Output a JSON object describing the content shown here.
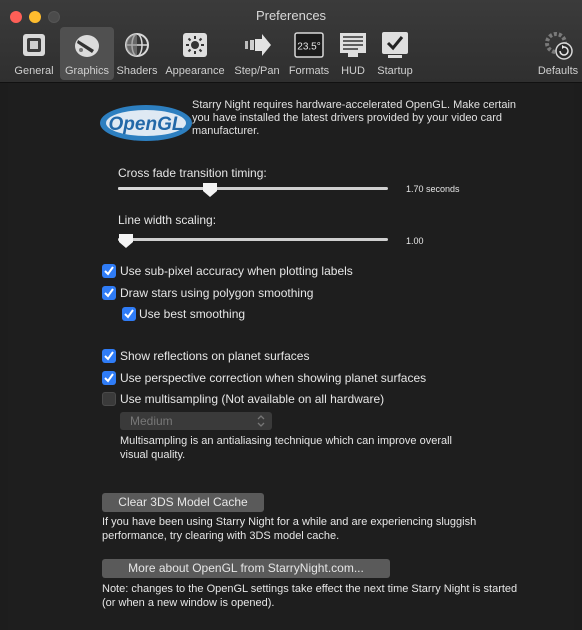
{
  "window": {
    "title": "Preferences"
  },
  "toolbar": {
    "items": [
      {
        "label": "General",
        "icon": "general-icon"
      },
      {
        "label": "Graphics",
        "icon": "graphics-icon",
        "selected": true
      },
      {
        "label": "Shaders",
        "icon": "shaders-icon"
      },
      {
        "label": "Appearance",
        "icon": "appearance-icon"
      },
      {
        "label": "Step/Pan",
        "icon": "step-pan-icon"
      },
      {
        "label": "Formats",
        "icon": "formats-icon",
        "icon_text": "23.5°"
      },
      {
        "label": "HUD",
        "icon": "hud-icon"
      },
      {
        "label": "Startup",
        "icon": "startup-icon"
      },
      {
        "label": "Defaults",
        "icon": "defaults-icon"
      }
    ]
  },
  "opengl": {
    "logo_text": "OpenGL",
    "intro": "Starry Night requires hardware-accelerated OpenGL. Make certain you have installed the latest drivers provided by your video card manufacturer."
  },
  "sliders": {
    "cross_fade": {
      "label": "Cross fade transition timing:",
      "value_text": "1.70 seconds",
      "fraction": 0.34
    },
    "line_width": {
      "label": "Line width scaling:",
      "value_text": "1.00",
      "fraction": 0.03
    }
  },
  "checkboxes": {
    "subpixel": {
      "label": "Use sub-pixel accuracy when plotting labels",
      "checked": true
    },
    "polygon": {
      "label": "Draw stars using polygon smoothing",
      "checked": true
    },
    "best_smoothing": {
      "label": "Use best smoothing",
      "checked": true
    },
    "reflections": {
      "label": "Show reflections on planet surfaces",
      "checked": true
    },
    "perspective": {
      "label": "Use perspective correction when showing planet surfaces",
      "checked": true
    },
    "multisampling": {
      "label": "Use multisampling (Not available on all hardware)",
      "checked": false
    }
  },
  "multisampling": {
    "popup_value": "Medium",
    "note": "Multisampling is an antialiasing technique which can improve overall visual quality."
  },
  "cache": {
    "button_label": "Clear 3DS Model Cache",
    "note": "If you have been using Starry Night for a while and are experiencing sluggish performance, try clearing with 3DS model cache."
  },
  "more": {
    "button_label": "More about OpenGL from StarryNight.com...",
    "note": "Note: changes to the OpenGL settings take effect the next time Starry Night is started (or when a new window is opened)."
  },
  "colors": {
    "accent": "#2f7cf6",
    "background": "#1e1e1e",
    "toolbar_selected": "#505050"
  }
}
